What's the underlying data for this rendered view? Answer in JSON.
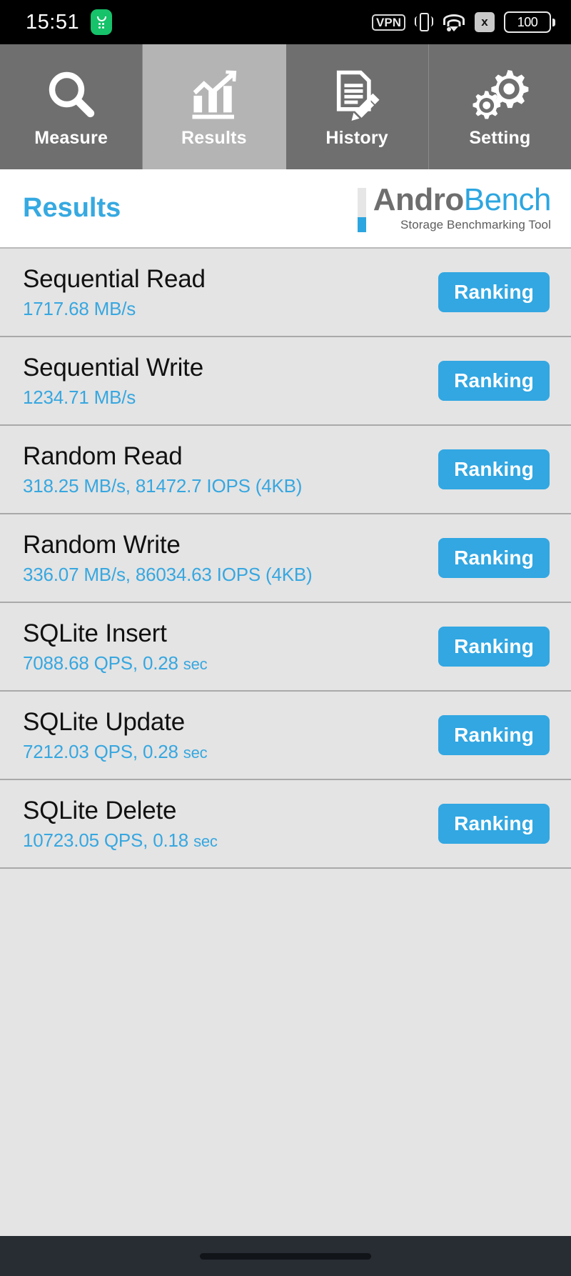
{
  "statusbar": {
    "time": "15:51",
    "notification_icon": "app-notification-icon",
    "vpn_label": "VPN",
    "vibrate_icon": "vibrate-icon",
    "wifi_icon": "wifi-icon",
    "x_badge_label": "x",
    "battery_level": "100"
  },
  "tabs": [
    {
      "label": "Measure",
      "icon": "magnifier-icon",
      "active": false
    },
    {
      "label": "Results",
      "icon": "bar-chart-icon",
      "active": true
    },
    {
      "label": "History",
      "icon": "document-pen-icon",
      "active": false
    },
    {
      "label": "Setting",
      "icon": "gears-icon",
      "active": false
    }
  ],
  "header": {
    "title": "Results",
    "logo_primary": "Andro",
    "logo_secondary": "Bench",
    "logo_subtitle": "Storage Benchmarking Tool"
  },
  "colors": {
    "accent_blue": "#32a7e2",
    "value_blue": "#37a7e0",
    "tab_inactive": "#706f6f",
    "tab_active": "#b4b4b4",
    "list_bg": "#e4e4e4"
  },
  "results": [
    {
      "name": "Sequential Read",
      "value": "1717.68 MB/s",
      "unit_small": "",
      "button": "Ranking"
    },
    {
      "name": "Sequential Write",
      "value": "1234.71 MB/s",
      "unit_small": "",
      "button": "Ranking"
    },
    {
      "name": "Random Read",
      "value": "318.25 MB/s, 81472.7 IOPS (4KB)",
      "unit_small": "",
      "button": "Ranking"
    },
    {
      "name": "Random Write",
      "value": "336.07 MB/s, 86034.63 IOPS (4KB)",
      "unit_small": "",
      "button": "Ranking"
    },
    {
      "name": "SQLite Insert",
      "value": "7088.68 QPS, 0.28",
      "unit_small": "sec",
      "button": "Ranking"
    },
    {
      "name": "SQLite Update",
      "value": "7212.03 QPS, 0.28",
      "unit_small": "sec",
      "button": "Ranking"
    },
    {
      "name": "SQLite Delete",
      "value": "10723.05 QPS, 0.18",
      "unit_small": "sec",
      "button": "Ranking"
    }
  ],
  "navbar": {
    "home_pill": "home-gesture-pill"
  }
}
